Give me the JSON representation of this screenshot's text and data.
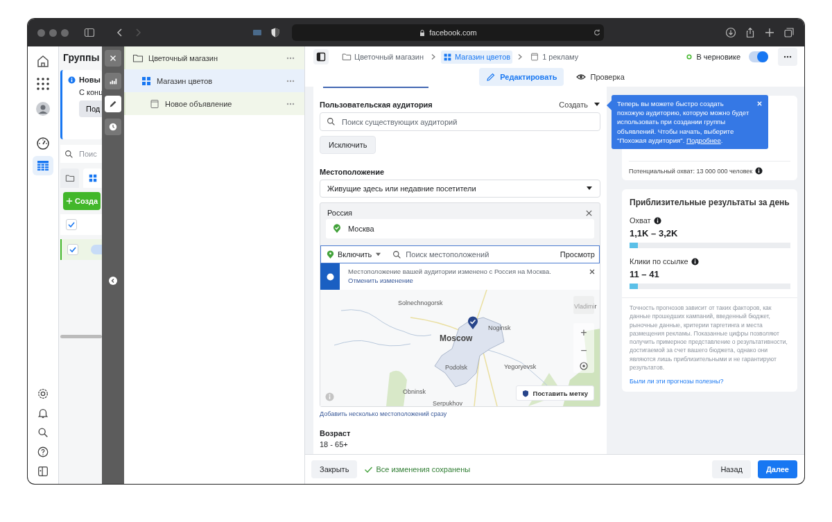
{
  "browser": {
    "address": "facebook.com"
  },
  "nav_rail": {
    "top_items": [
      {
        "selected": false
      },
      {
        "selected": false
      },
      {
        "selected": false
      },
      {
        "selected": false
      },
      {
        "selected": true
      }
    ],
    "bottom_items": [
      {
        "selected": false
      },
      {
        "selected": false
      },
      {
        "selected": false
      },
      {
        "selected": false
      },
      {
        "selected": false
      }
    ]
  },
  "campaign_list": {
    "title": "Группы",
    "notice": {
      "title": "Новы",
      "text": "С конц",
      "button": "Под"
    },
    "search": {
      "placeholder": "Поис"
    },
    "tabs": [
      {
        "selected": false
      },
      {
        "selected": true
      }
    ],
    "create_button": "Созда",
    "rows": [
      {
        "checked": true,
        "selected": false
      },
      {
        "checked": true,
        "selected": true
      }
    ]
  },
  "tool_strip": {
    "items": [
      {
        "selected": false
      },
      {
        "selected": false
      },
      {
        "selected": true
      },
      {
        "selected": false
      }
    ]
  },
  "tree": [
    {
      "label": "Цветочный магазин",
      "selected": false,
      "children": [
        {
          "label": "Магазин цветов",
          "selected": true,
          "children": [
            {
              "label": "Новое объявление",
              "selected": false
            }
          ]
        }
      ]
    }
  ],
  "breadcrumbs": [
    {
      "label": "Цветочный магазин",
      "selected": false
    },
    {
      "label": "Магазин цветов",
      "selected": true
    },
    {
      "label": "1 рекламу",
      "selected": false
    }
  ],
  "status": {
    "label": "В черновике",
    "on": true
  },
  "mode_tabs": [
    {
      "label": "Редактировать",
      "selected": true
    },
    {
      "label": "Проверка",
      "selected": false
    }
  ],
  "audience": {
    "label": "Пользовательская аудитория",
    "create": "Создать",
    "search_placeholder": "Поиск существующих аудиторий",
    "exclude_button": "Исключить"
  },
  "location": {
    "label": "Местоположение",
    "dropdown": "Живущие здесь или недавние посетители",
    "country": "Россия",
    "places": [
      "Москва"
    ],
    "include": "Включить",
    "search_placeholder": "Поиск местоположений",
    "browse": "Просмотр",
    "notice": "Местоположение вашей аудитории изменено с Россия на Москва. ",
    "notice_link": "Отменить изменение",
    "map": {
      "places": [
        "Solnechnogorsk",
        "Moscow",
        "Noginsk",
        "Podolsk",
        "Yegoryevsk",
        "Obninsk",
        "Serpukhov",
        "Vladimir"
      ],
      "zoom_in": "+",
      "zoom_out": "−",
      "drop_pin": "Поставить метку"
    },
    "bulk_link": "Добавить несколько местоположений сразу"
  },
  "age": {
    "label": "Возраст",
    "value": "18 - 65+"
  },
  "tooltip": {
    "text": "Теперь вы можете быстро создать похожую аудиторию, которую можно будет использовать при создании группы объявлений. Чтобы начать, выберите \"Похожая аудитория\". ",
    "link": "Подробнее",
    "end": "."
  },
  "audience_size": {
    "text": "Потенциальный охват: 13 000 000 человек"
  },
  "estimates": {
    "title": "Приблизительные результаты за день",
    "metrics": [
      {
        "label": "Охват",
        "value": "1,1K – 3,2K",
        "level": 0.05
      },
      {
        "label": "Клики по ссылке",
        "value": "11 – 41",
        "level": 0.05
      }
    ],
    "disclaimer": "Точность прогнозов зависит от таких факторов, как данные прошедших кампаний, введенный бюджет, рыночные данные, критерии таргетинга и места размещения рекламы. Показанные цифры позволяют получить примерное представление о результативности, достигаемой за счет вашего бюджета, однако они являются лишь приблизительными и не гарантируют результатов.",
    "feedback_link": "Были ли эти прогнозы полезны?"
  },
  "footer": {
    "close": "Закрыть",
    "saved": "Все изменения сохранены",
    "back": "Назад",
    "next": "Далее"
  }
}
